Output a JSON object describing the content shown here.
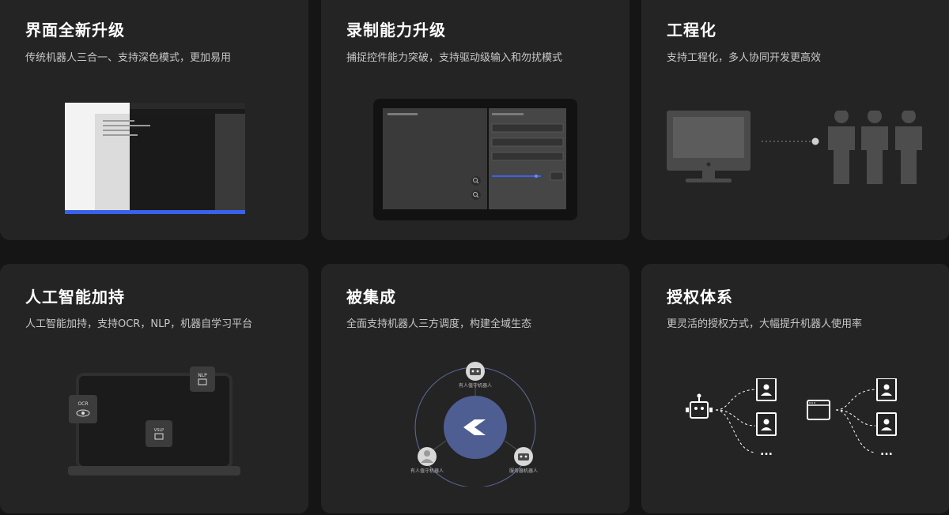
{
  "cards": [
    {
      "title": "界面全新升级",
      "desc": "传统机器人三合一、支持深色模式，更加易用"
    },
    {
      "title": "录制能力升级",
      "desc": "捕捉控件能力突破，支持驱动级输入和勿扰模式"
    },
    {
      "title": "工程化",
      "desc": "支持工程化，多人协同开发更高效"
    },
    {
      "title": "人工智能加持",
      "desc": "人工智能加持，支持OCR，NLP，机器自学习平台"
    },
    {
      "title": "被集成",
      "desc": "全面支持机器人三方调度，构建全域生态"
    },
    {
      "title": "授权体系",
      "desc": "更灵活的授权方式，大幅提升机器人使用率"
    }
  ],
  "ai_badges": {
    "ocr": "OCR",
    "nlp": "NLP",
    "vslp": "VSLP"
  },
  "integration_labels": {
    "top": "有人值守机器人",
    "left": "有人值守机器人",
    "right": "服务器机器人"
  },
  "license_more": [
    "...",
    "..."
  ],
  "colors": {
    "accent": "#3a62e8",
    "card_bg": "#242424",
    "page_bg": "#151515"
  },
  "icons": [
    "zoom-in-icon",
    "zoom-out-icon",
    "robot-icon",
    "user-icon",
    "browser-window-icon",
    "eye-icon",
    "monitor-icon",
    "person-icon"
  ]
}
